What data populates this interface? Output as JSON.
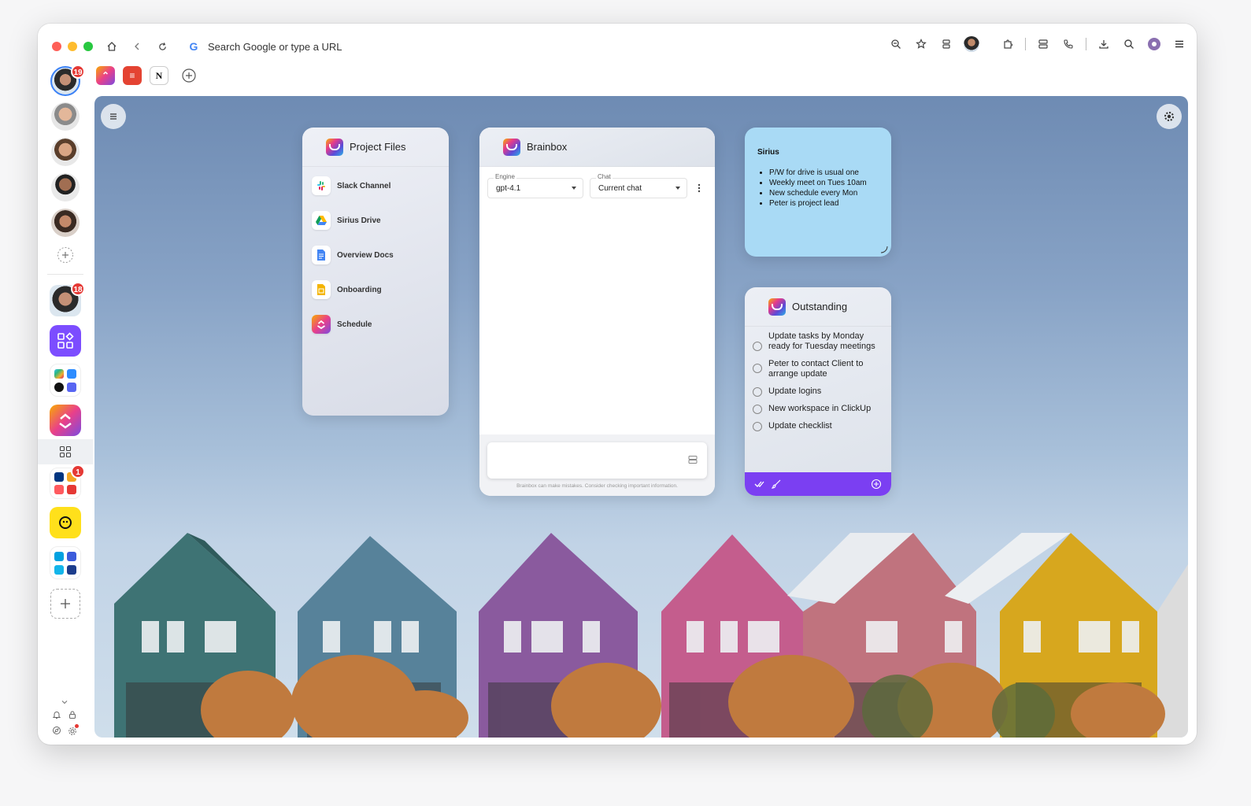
{
  "browser": {
    "url_placeholder": "Search Google or type a URL",
    "toolbar_icons": [
      "zoom-icon",
      "star-icon",
      "tab-stack-icon",
      "profile-avatar",
      "extensions-icon",
      "storage-icon",
      "phone-icon",
      "download-icon",
      "search-icon",
      "account-icon",
      "menu-icon"
    ]
  },
  "sidebar": {
    "top_avatar_badge": "19",
    "workspace_avatar_badge": "18",
    "group_badge": "1"
  },
  "tabs": [
    "clickup-tab",
    "todoist-tab",
    "notion-tab",
    "new-tab"
  ],
  "project_files": {
    "title": "Project Files",
    "items": [
      {
        "label": "Slack Channel",
        "icon": "slack-icon"
      },
      {
        "label": "Sirius Drive",
        "icon": "drive-icon"
      },
      {
        "label": "Overview Docs",
        "icon": "docs-icon"
      },
      {
        "label": "Onboarding",
        "icon": "slides-icon"
      },
      {
        "label": "Schedule",
        "icon": "clickup-icon"
      }
    ]
  },
  "brainbox": {
    "title": "Brainbox",
    "engine_label": "Engine",
    "engine_value": "gpt-4.1",
    "chat_label": "Chat",
    "chat_value": "Current chat",
    "disclaimer": "Brainbox can make mistakes. Consider checking important information."
  },
  "note": {
    "title": "Sirius",
    "bullets": [
      "P/W for drive is usual one",
      "Weekly meet on Tues 10am",
      "New schedule every Mon",
      "Peter is project lead"
    ]
  },
  "outstanding": {
    "title": "Outstanding",
    "tasks": [
      "Update tasks by Monday ready for Tuesday meetings",
      "Peter to contact Client to arrange update",
      "Update logins",
      "New workspace in ClickUp",
      "Update checklist"
    ],
    "accent": "#7b3ff2"
  }
}
